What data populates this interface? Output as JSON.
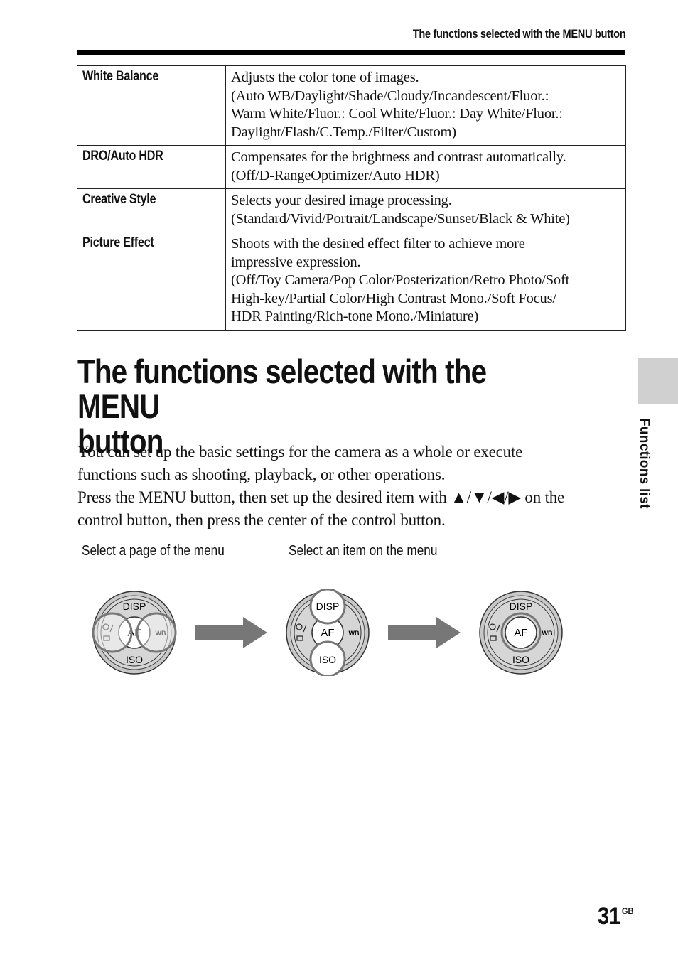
{
  "header": {
    "running_title": "The functions selected with the MENU button"
  },
  "table": {
    "rows": [
      {
        "name": "White Balance",
        "lines": [
          "Adjusts the color tone of images.",
          "(Auto WB/Daylight/Shade/Cloudy/Incandescent/Fluor.:",
          "Warm White/Fluor.: Cool White/Fluor.: Day White/Fluor.:",
          "Daylight/Flash/C.Temp./Filter/Custom)"
        ]
      },
      {
        "name": "DRO/Auto HDR",
        "lines": [
          "Compensates for the brightness and contrast automatically.",
          "(Off/D-RangeOptimizer/Auto HDR)"
        ]
      },
      {
        "name": "Creative Style",
        "lines": [
          "Selects your desired image processing.",
          "(Standard/Vivid/Portrait/Landscape/Sunset/Black & White)"
        ]
      },
      {
        "name": "Picture Effect",
        "lines": [
          "Shoots with the desired effect filter to achieve more",
          "impressive expression.",
          "(Off/Toy Camera/Pop Color/Posterization/Retro Photo/Soft",
          "High-key/Partial Color/High Contrast Mono./Soft Focus/",
          "HDR Painting/Rich-tone Mono./Miniature)"
        ]
      }
    ]
  },
  "section": {
    "title_line1": "The functions selected with the MENU",
    "title_line2": "button",
    "paragraph1_line1": "You can set up the basic settings for the camera as a whole or execute",
    "paragraph1_line2": "functions such as shooting, playback, or other operations.",
    "paragraph2_line1": "Press the MENU button, then set up the desired item with ▲/▼/◀/▶ on the",
    "paragraph2_line2": "control button, then press the center of the control button."
  },
  "diagram": {
    "caption_left": "Select a page of the menu",
    "caption_middle": "Select an item on the menu",
    "dial_labels": {
      "top": "DISP",
      "bottom": "ISO",
      "center": "AF",
      "right": "WB",
      "left_icon": "self-timer/drive-mode"
    },
    "steps": [
      {
        "highlight": "left-right"
      },
      {
        "highlight": "up-down"
      },
      {
        "highlight": "center"
      }
    ]
  },
  "sidebar": {
    "section_label": "Functions list"
  },
  "footer": {
    "page_number": "31",
    "region_code": "GB"
  }
}
